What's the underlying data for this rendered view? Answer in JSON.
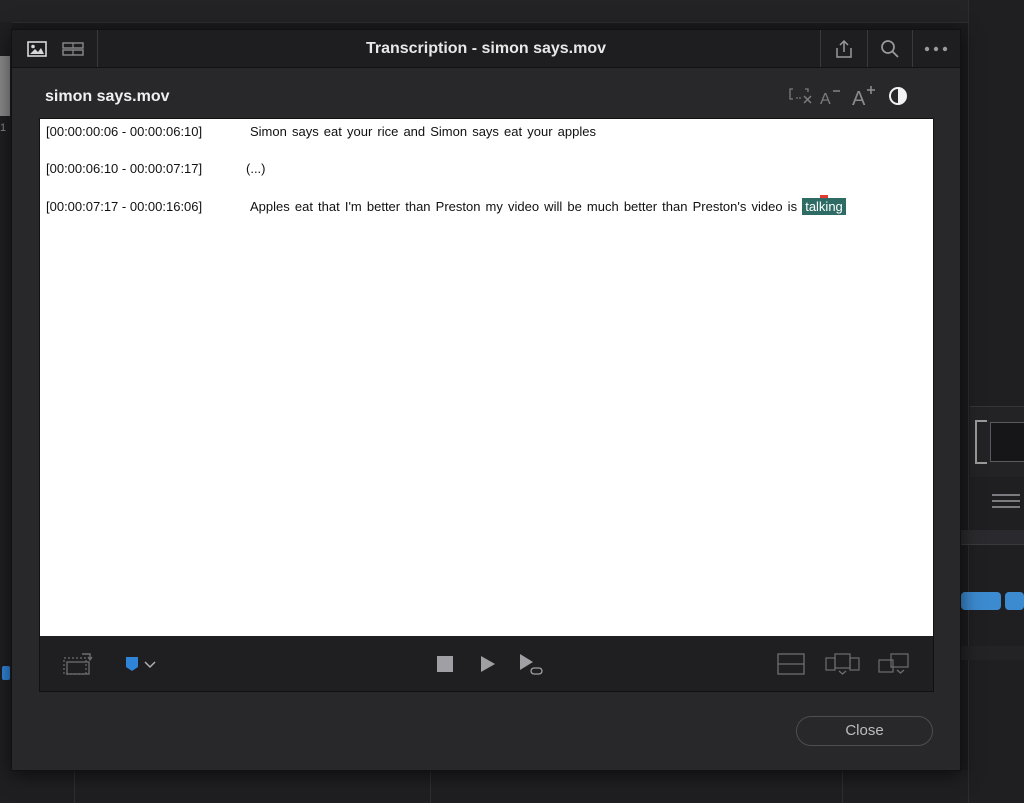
{
  "dialog": {
    "title": "Transcription - simon says.mov",
    "doc_name": "simon says.mov",
    "close_label": "Close"
  },
  "transcript": [
    {
      "timestamp": "[00:00:00:06 - 00:00:06:10]",
      "text": "Simon says eat your rice and Simon says eat your apples"
    },
    {
      "timestamp": "[00:00:06:10 - 00:00:07:17]",
      "text": "(...)"
    },
    {
      "timestamp": "[00:00:07:17 - 00:00:16:06]",
      "text": "Apples eat that I'm better than Preston my video will be much better than Preston's video is",
      "highlighted_word": "talking"
    }
  ],
  "background": {
    "left_number": "1"
  },
  "icons": {
    "titlebar": [
      "image-view-icon",
      "grid-view-icon",
      "export-icon",
      "search-icon",
      "more-icon"
    ],
    "text_tools": [
      "clear-selection-icon",
      "decrease-font-icon",
      "increase-font-icon",
      "contrast-icon"
    ],
    "controls": [
      "sync-icon",
      "marker-color-icon",
      "stop-icon",
      "play-icon",
      "play-loop-icon",
      "layout-single-icon",
      "layout-split-icon",
      "layout-dual-icon"
    ]
  },
  "colors": {
    "highlight": "#2e6b64",
    "marker": "#2f84d8",
    "caret": "#e53935",
    "dialog_bg": "#28282b"
  }
}
